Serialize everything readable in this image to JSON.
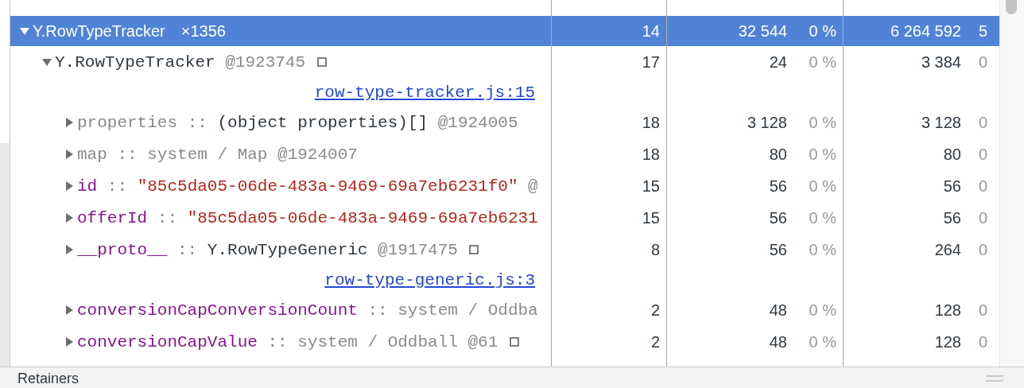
{
  "tree": [
    {
      "kind": "group",
      "name": "Y.RowTypeTracker",
      "count": "×1356",
      "distance": "14",
      "shallow_size": "32 544",
      "shallow_percent": "0 %",
      "retained_size": "6 264 592",
      "retained_percent": "5",
      "expanded": true,
      "selected": true,
      "children": [
        {
          "kind": "object",
          "segments": [
            {
              "kind": "type",
              "text": "Y.RowTypeTracker"
            },
            {
              "kind": "id",
              "text": "@1923745"
            }
          ],
          "reveal_icon": true,
          "link": "row-type-tracker.js:15",
          "distance": "17",
          "shallow_size": "24",
          "shallow_percent": "0 %",
          "retained_size": "3 384",
          "retained_percent": "0",
          "expanded": true,
          "selected": false,
          "children": [
            {
              "kind": "object",
              "segments": [
                {
                  "kind": "internal",
                  "text": "properties"
                },
                {
                  "kind": "sep",
                  "text": "::"
                },
                {
                  "kind": "type",
                  "text": "(object properties)[]"
                },
                {
                  "kind": "id",
                  "text": "@1924005"
                }
              ],
              "reveal_icon": false,
              "distance": "18",
              "shallow_size": "3 128",
              "shallow_percent": "0 %",
              "retained_size": "3 128",
              "retained_percent": "0",
              "expanded": false,
              "selected": false
            },
            {
              "kind": "object",
              "segments": [
                {
                  "kind": "internal",
                  "text": "map"
                },
                {
                  "kind": "sep",
                  "text": "::"
                },
                {
                  "kind": "system",
                  "text": "system / Map"
                },
                {
                  "kind": "id",
                  "text": "@1924007"
                }
              ],
              "reveal_icon": false,
              "distance": "18",
              "shallow_size": "80",
              "shallow_percent": "0 %",
              "retained_size": "80",
              "retained_percent": "0",
              "expanded": false,
              "selected": false
            },
            {
              "kind": "object",
              "segments": [
                {
                  "kind": "key",
                  "text": "id"
                },
                {
                  "kind": "sep",
                  "text": "::"
                },
                {
                  "kind": "string",
                  "text": "\"85c5da05-06de-483a-9469-69a7eb6231f0\""
                },
                {
                  "kind": "id",
                  "text": "@"
                }
              ],
              "reveal_icon": false,
              "distance": "15",
              "shallow_size": "56",
              "shallow_percent": "0 %",
              "retained_size": "56",
              "retained_percent": "0",
              "expanded": false,
              "selected": false
            },
            {
              "kind": "object",
              "segments": [
                {
                  "kind": "key",
                  "text": "offerId"
                },
                {
                  "kind": "sep",
                  "text": "::"
                },
                {
                  "kind": "string",
                  "text": "\"85c5da05-06de-483a-9469-69a7eb6231"
                }
              ],
              "reveal_icon": false,
              "distance": "15",
              "shallow_size": "56",
              "shallow_percent": "0 %",
              "retained_size": "56",
              "retained_percent": "0",
              "expanded": false,
              "selected": false
            },
            {
              "kind": "object",
              "segments": [
                {
                  "kind": "key",
                  "text": "__proto__"
                },
                {
                  "kind": "sep",
                  "text": "::"
                },
                {
                  "kind": "type",
                  "text": "Y.RowTypeGeneric"
                },
                {
                  "kind": "id",
                  "text": "@1917475"
                }
              ],
              "reveal_icon": true,
              "link": "row-type-generic.js:3",
              "distance": "8",
              "shallow_size": "56",
              "shallow_percent": "0 %",
              "retained_size": "264",
              "retained_percent": "0",
              "expanded": false,
              "selected": false
            },
            {
              "kind": "object",
              "segments": [
                {
                  "kind": "key",
                  "text": "conversionCapConversionCount"
                },
                {
                  "kind": "sep",
                  "text": "::"
                },
                {
                  "kind": "system",
                  "text": "system / Oddba"
                }
              ],
              "reveal_icon": false,
              "distance": "2",
              "shallow_size": "48",
              "shallow_percent": "0 %",
              "retained_size": "128",
              "retained_percent": "0",
              "expanded": false,
              "selected": false
            },
            {
              "kind": "object",
              "segments": [
                {
                  "kind": "key",
                  "text": "conversionCapValue"
                },
                {
                  "kind": "sep",
                  "text": "::"
                },
                {
                  "kind": "system",
                  "text": "system / Oddball"
                },
                {
                  "kind": "id",
                  "text": "@61"
                }
              ],
              "reveal_icon": true,
              "distance": "2",
              "shallow_size": "48",
              "shallow_percent": "0 %",
              "retained_size": "128",
              "retained_percent": "0",
              "expanded": false,
              "selected": false
            }
          ]
        }
      ]
    }
  ],
  "bottom_panel": {
    "title": "Retainers"
  }
}
